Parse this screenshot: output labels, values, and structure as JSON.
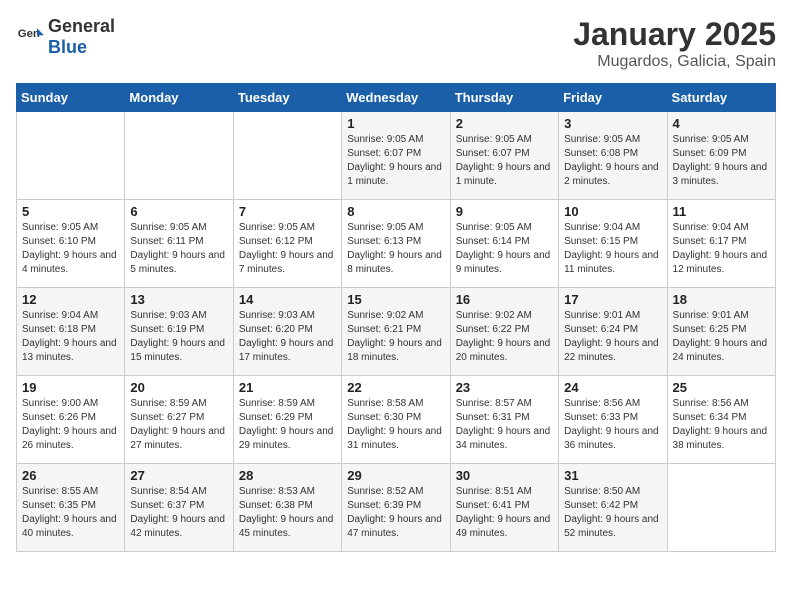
{
  "logo": {
    "general": "General",
    "blue": "Blue"
  },
  "title": "January 2025",
  "subtitle": "Mugardos, Galicia, Spain",
  "days_header": [
    "Sunday",
    "Monday",
    "Tuesday",
    "Wednesday",
    "Thursday",
    "Friday",
    "Saturday"
  ],
  "weeks": [
    [
      {
        "day": "",
        "info": ""
      },
      {
        "day": "",
        "info": ""
      },
      {
        "day": "",
        "info": ""
      },
      {
        "day": "1",
        "info": "Sunrise: 9:05 AM\nSunset: 6:07 PM\nDaylight: 9 hours and 1 minute."
      },
      {
        "day": "2",
        "info": "Sunrise: 9:05 AM\nSunset: 6:07 PM\nDaylight: 9 hours and 1 minute."
      },
      {
        "day": "3",
        "info": "Sunrise: 9:05 AM\nSunset: 6:08 PM\nDaylight: 9 hours and 2 minutes."
      },
      {
        "day": "4",
        "info": "Sunrise: 9:05 AM\nSunset: 6:09 PM\nDaylight: 9 hours and 3 minutes."
      }
    ],
    [
      {
        "day": "5",
        "info": "Sunrise: 9:05 AM\nSunset: 6:10 PM\nDaylight: 9 hours and 4 minutes."
      },
      {
        "day": "6",
        "info": "Sunrise: 9:05 AM\nSunset: 6:11 PM\nDaylight: 9 hours and 5 minutes."
      },
      {
        "day": "7",
        "info": "Sunrise: 9:05 AM\nSunset: 6:12 PM\nDaylight: 9 hours and 7 minutes."
      },
      {
        "day": "8",
        "info": "Sunrise: 9:05 AM\nSunset: 6:13 PM\nDaylight: 9 hours and 8 minutes."
      },
      {
        "day": "9",
        "info": "Sunrise: 9:05 AM\nSunset: 6:14 PM\nDaylight: 9 hours and 9 minutes."
      },
      {
        "day": "10",
        "info": "Sunrise: 9:04 AM\nSunset: 6:15 PM\nDaylight: 9 hours and 11 minutes."
      },
      {
        "day": "11",
        "info": "Sunrise: 9:04 AM\nSunset: 6:17 PM\nDaylight: 9 hours and 12 minutes."
      }
    ],
    [
      {
        "day": "12",
        "info": "Sunrise: 9:04 AM\nSunset: 6:18 PM\nDaylight: 9 hours and 13 minutes."
      },
      {
        "day": "13",
        "info": "Sunrise: 9:03 AM\nSunset: 6:19 PM\nDaylight: 9 hours and 15 minutes."
      },
      {
        "day": "14",
        "info": "Sunrise: 9:03 AM\nSunset: 6:20 PM\nDaylight: 9 hours and 17 minutes."
      },
      {
        "day": "15",
        "info": "Sunrise: 9:02 AM\nSunset: 6:21 PM\nDaylight: 9 hours and 18 minutes."
      },
      {
        "day": "16",
        "info": "Sunrise: 9:02 AM\nSunset: 6:22 PM\nDaylight: 9 hours and 20 minutes."
      },
      {
        "day": "17",
        "info": "Sunrise: 9:01 AM\nSunset: 6:24 PM\nDaylight: 9 hours and 22 minutes."
      },
      {
        "day": "18",
        "info": "Sunrise: 9:01 AM\nSunset: 6:25 PM\nDaylight: 9 hours and 24 minutes."
      }
    ],
    [
      {
        "day": "19",
        "info": "Sunrise: 9:00 AM\nSunset: 6:26 PM\nDaylight: 9 hours and 26 minutes."
      },
      {
        "day": "20",
        "info": "Sunrise: 8:59 AM\nSunset: 6:27 PM\nDaylight: 9 hours and 27 minutes."
      },
      {
        "day": "21",
        "info": "Sunrise: 8:59 AM\nSunset: 6:29 PM\nDaylight: 9 hours and 29 minutes."
      },
      {
        "day": "22",
        "info": "Sunrise: 8:58 AM\nSunset: 6:30 PM\nDaylight: 9 hours and 31 minutes."
      },
      {
        "day": "23",
        "info": "Sunrise: 8:57 AM\nSunset: 6:31 PM\nDaylight: 9 hours and 34 minutes."
      },
      {
        "day": "24",
        "info": "Sunrise: 8:56 AM\nSunset: 6:33 PM\nDaylight: 9 hours and 36 minutes."
      },
      {
        "day": "25",
        "info": "Sunrise: 8:56 AM\nSunset: 6:34 PM\nDaylight: 9 hours and 38 minutes."
      }
    ],
    [
      {
        "day": "26",
        "info": "Sunrise: 8:55 AM\nSunset: 6:35 PM\nDaylight: 9 hours and 40 minutes."
      },
      {
        "day": "27",
        "info": "Sunrise: 8:54 AM\nSunset: 6:37 PM\nDaylight: 9 hours and 42 minutes."
      },
      {
        "day": "28",
        "info": "Sunrise: 8:53 AM\nSunset: 6:38 PM\nDaylight: 9 hours and 45 minutes."
      },
      {
        "day": "29",
        "info": "Sunrise: 8:52 AM\nSunset: 6:39 PM\nDaylight: 9 hours and 47 minutes."
      },
      {
        "day": "30",
        "info": "Sunrise: 8:51 AM\nSunset: 6:41 PM\nDaylight: 9 hours and 49 minutes."
      },
      {
        "day": "31",
        "info": "Sunrise: 8:50 AM\nSunset: 6:42 PM\nDaylight: 9 hours and 52 minutes."
      },
      {
        "day": "",
        "info": ""
      }
    ]
  ]
}
